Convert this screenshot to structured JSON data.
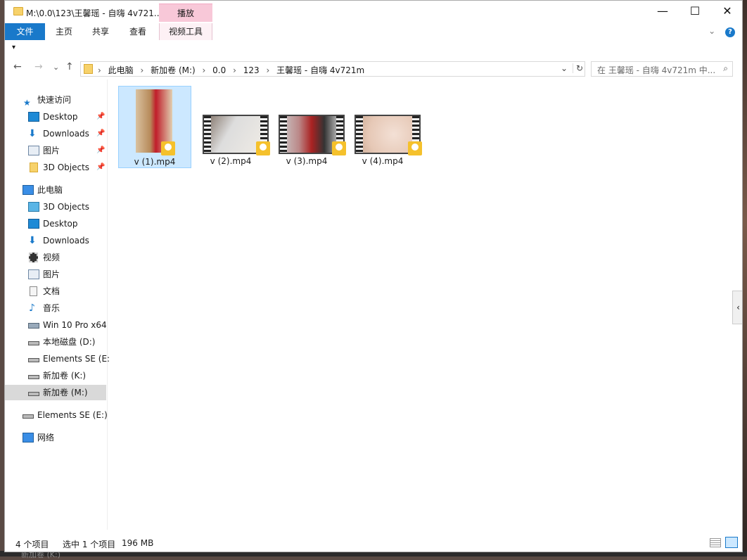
{
  "window": {
    "title": "M:\\0.0\\123\\王馨瑶 - 自嗨 4v721...",
    "context_tab_header": "播放",
    "minimize": "—",
    "maximize": "☐",
    "close": "✕"
  },
  "ribbon": {
    "tabs": [
      "文件",
      "主页",
      "共享",
      "查看",
      "视频工具"
    ],
    "collapse": "⌄",
    "help": "?"
  },
  "qat": "▾",
  "nav": {
    "back": "←",
    "forward": "→",
    "recent": "⌄",
    "up": "↑",
    "breadcrumbs": [
      "此电脑",
      "新加卷 (M:)",
      "0.0",
      "123",
      "王馨瑶 - 自嗨 4v721m"
    ],
    "separator": "›",
    "dropdown": "⌄",
    "refresh": "↻",
    "search_placeholder": "在 王馨瑶 - 自嗨 4v721m 中...",
    "search_icon": "⌕"
  },
  "sidebar": {
    "quick_access": "快速访问",
    "quick_items": [
      "Desktop",
      "Downloads",
      "图片",
      "3D Objects"
    ],
    "pin": "📌",
    "this_pc": "此电脑",
    "pc_items": [
      "3D Objects",
      "Desktop",
      "Downloads",
      "视频",
      "图片",
      "文档",
      "音乐",
      "Win 10 Pro x64",
      "本地磁盘 (D:)",
      "Elements SE (E:",
      "新加卷 (K:)",
      "新加卷 (M:)"
    ],
    "external": "Elements SE (E:)",
    "network": "网络"
  },
  "files": [
    {
      "name": "v (1).mp4",
      "selected": true
    },
    {
      "name": "v (2).mp4",
      "selected": false
    },
    {
      "name": "v (3).mp4",
      "selected": false
    },
    {
      "name": "v (4).mp4",
      "selected": false
    }
  ],
  "status": {
    "count": "4 个项目",
    "selection": "选中 1 个项目",
    "size": "196 MB"
  },
  "side_tab": "‹",
  "background_label": "新加卷 (K:)",
  "colors": {
    "accent": "#1979ca",
    "selection": "#cce8ff",
    "context_tab": "#f8c8d8"
  }
}
